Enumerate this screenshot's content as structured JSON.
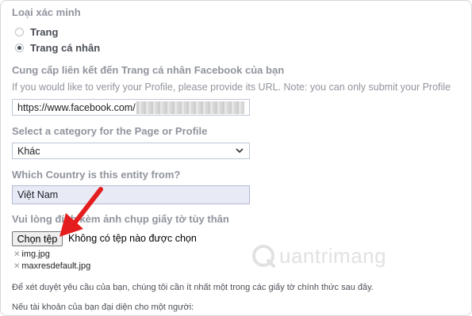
{
  "verification_type": {
    "label": "Loại xác minh",
    "options": [
      {
        "label": "Trang",
        "selected": false
      },
      {
        "label": "Trang cá nhân",
        "selected": true
      }
    ]
  },
  "profile_link": {
    "label": "Cung cấp liên kết đến Trang cá nhân Facebook của bạn",
    "help": "If you would like to verify your Profile, please provide its URL. Note: you can only submit your Profile",
    "value": "https://www.facebook.com/"
  },
  "category": {
    "label": "Select a category for the Page or Profile",
    "selected": "Khác"
  },
  "country": {
    "label": "Which Country is this entity from?",
    "value": "Việt Nam"
  },
  "id_upload": {
    "label": "Vui lòng đính kèm ảnh chụp giấy tờ tùy thân",
    "button_label": "Chọn tệp",
    "status": "Không có tệp nào được chọn",
    "files": [
      "img.jpg",
      "maxresdefault.jpg"
    ]
  },
  "info": {
    "line1": "Để xét duyệt yêu cầu của bạn, chúng tôi cần ít nhất một trong các giấy tờ chính thức sau đây.",
    "line2": "Nếu tài khoản của bạn đại diện cho một người:"
  },
  "watermark": "uantrimang",
  "colors": {
    "arrow": "#e41e1e",
    "label_gray": "#90949c",
    "country_bg": "#e8eaf6"
  }
}
